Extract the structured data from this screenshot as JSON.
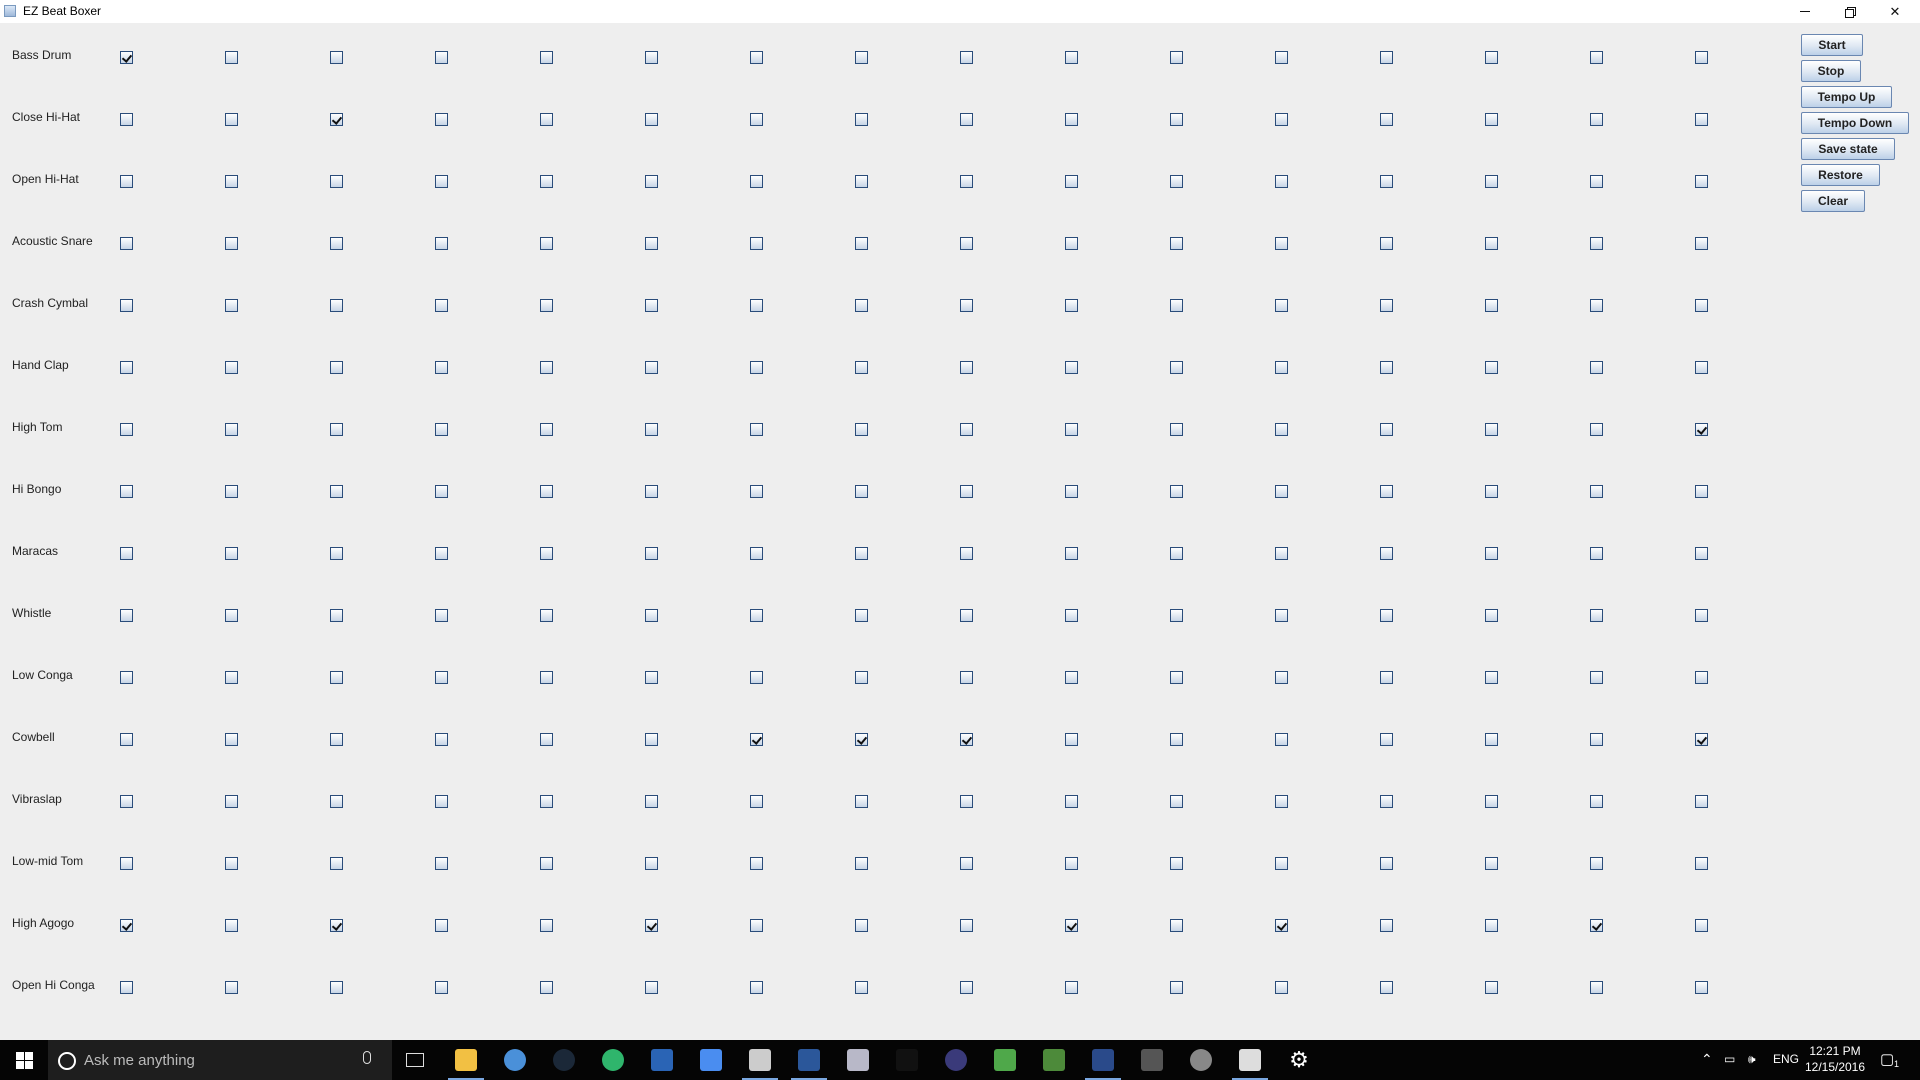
{
  "window": {
    "title": "EZ Beat Boxer"
  },
  "instruments": [
    {
      "name": "Bass Drum",
      "checked": [
        0
      ]
    },
    {
      "name": "Close Hi-Hat",
      "checked": [
        2
      ]
    },
    {
      "name": "Open Hi-Hat",
      "checked": []
    },
    {
      "name": "Acoustic Snare",
      "checked": []
    },
    {
      "name": "Crash Cymbal",
      "checked": []
    },
    {
      "name": "Hand Clap",
      "checked": []
    },
    {
      "name": "High Tom",
      "checked": [
        15
      ]
    },
    {
      "name": "Hi Bongo",
      "checked": []
    },
    {
      "name": "Maracas",
      "checked": []
    },
    {
      "name": "Whistle",
      "checked": []
    },
    {
      "name": "Low Conga",
      "checked": []
    },
    {
      "name": "Cowbell",
      "checked": [
        6,
        7,
        8,
        15
      ]
    },
    {
      "name": "Vibraslap",
      "checked": []
    },
    {
      "name": "Low-mid Tom",
      "checked": []
    },
    {
      "name": "High Agogo",
      "checked": [
        0,
        2,
        5,
        9,
        11,
        14
      ]
    },
    {
      "name": "Open Hi Conga",
      "checked": []
    }
  ],
  "beats_per_row": 16,
  "buttons": {
    "start": "Start",
    "stop": "Stop",
    "tempo_up": "Tempo Up",
    "tempo_down": "Tempo Down",
    "save_state": "Save state",
    "restore": "Restore",
    "clear": "Clear"
  },
  "taskbar": {
    "search_placeholder": "Ask me anything",
    "language": "ENG",
    "time": "12:21 PM",
    "date": "12/15/2016",
    "notification_count": "1",
    "apps": [
      {
        "name": "file-explorer",
        "color": "#f2c043"
      },
      {
        "name": "chrome",
        "color": "#4a90d9"
      },
      {
        "name": "steam",
        "color": "#1b2838"
      },
      {
        "name": "android-studio-green",
        "color": "#2fb56c"
      },
      {
        "name": "powershell",
        "color": "#2a64b5"
      },
      {
        "name": "app-blue-diamond",
        "color": "#4a8df0"
      },
      {
        "name": "calculator",
        "color": "#cccccc"
      },
      {
        "name": "word",
        "color": "#2b579a"
      },
      {
        "name": "app-robot",
        "color": "#b8b8c8"
      },
      {
        "name": "command-prompt",
        "color": "#111111"
      },
      {
        "name": "eclipse",
        "color": "#3a3a7a"
      },
      {
        "name": "android-studio",
        "color": "#4fa84a"
      },
      {
        "name": "app-globe",
        "color": "#4d8a3a"
      },
      {
        "name": "knife-app",
        "color": "#2a4a8a"
      },
      {
        "name": "live-app",
        "color": "#555555"
      },
      {
        "name": "app-elephant",
        "color": "#888888"
      },
      {
        "name": "java",
        "color": "#dddddd"
      },
      {
        "name": "settings",
        "color": "#ffffff"
      }
    ]
  }
}
